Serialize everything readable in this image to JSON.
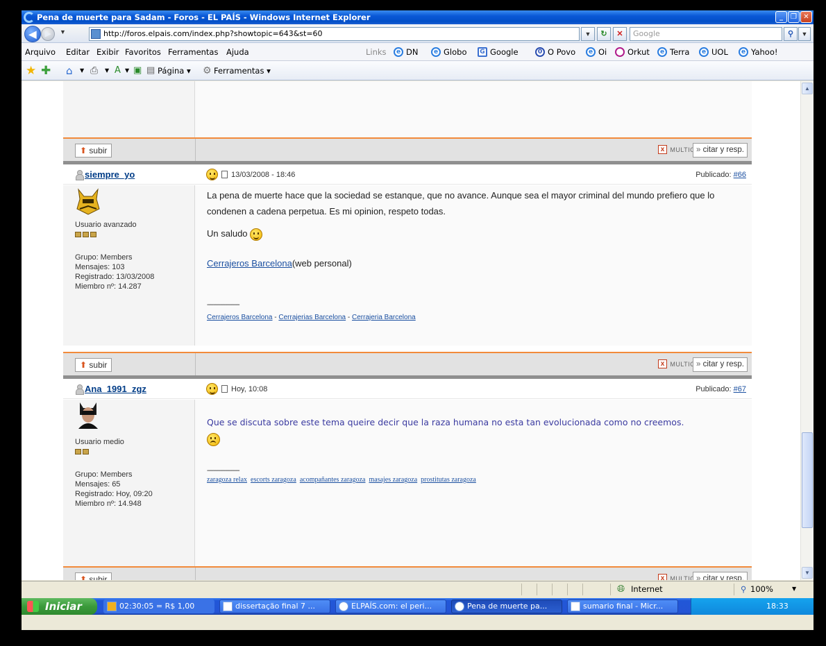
{
  "window": {
    "title": "Pena de muerte para Sadam - Foros - EL PAÍS - Windows Internet Explorer"
  },
  "address": {
    "url": "http://foros.elpais.com/index.php?showtopic=643&st=60",
    "search_placeholder": "Google"
  },
  "menu": [
    "Arquivo",
    "Editar",
    "Exibir",
    "Favoritos",
    "Ferramentas",
    "Ajuda"
  ],
  "links": {
    "label": "Links",
    "items": [
      "DN",
      "Globo",
      "Google",
      "O Povo",
      "Oi",
      "Orkut",
      "Terra",
      "UOL",
      "Yahoo!"
    ]
  },
  "command": {
    "pagina": "Página",
    "ferramentas": "Ferramentas"
  },
  "common": {
    "subir": "subir",
    "multicita": "MULTICITA",
    "citar": "citar y resp.",
    "publicado": "Publicado:"
  },
  "posts": [
    {
      "user": "siempre_yo",
      "date": "13/03/2008 - 18:46",
      "num": "#66",
      "role": "Usuario avanzado",
      "pips": 3,
      "grupo": "Grupo: Members",
      "mensajes": "Mensajes: 103",
      "registrado": "Registrado: 13/03/2008",
      "miembro": "Miembro nº: 14.287",
      "text1": "La pena de muerte hace que la sociedad se estanque, que no avance. Aunque sea el mayor criminal del mundo prefiero que lo",
      "text2": "condenen a cadena perpetua. Es mi opinion, respeto todas.",
      "saludo": "Un saludo",
      "link": "Cerrajeros Barcelona",
      "link_suffix": "(web personal)",
      "sigline": "--------------------",
      "sig": [
        "Cerrajeros Barcelona",
        "Cerrajerias Barcelona",
        "Cerrajeria Barcelona"
      ]
    },
    {
      "user": "Ana_1991_zgz",
      "date": "Hoy, 10:08",
      "num": "#67",
      "role": "Usuario medio",
      "pips": 2,
      "grupo": "Grupo: Members",
      "mensajes": "Mensajes: 65",
      "registrado": "Registrado: Hoy, 09:20",
      "miembro": "Miembro nº: 14.948",
      "text": "Que se discuta sobre este tema queire decir que la raza humana no esta tan evolucionada como no creemos.",
      "sigline": "--------------------",
      "sig": [
        "zaragoza relax",
        "escorts zaragoza",
        "acompañantes zaragoza",
        "masajes zaragoza",
        "prostitutas zaragoza"
      ]
    }
  ],
  "status": {
    "zone": "Internet",
    "zoom": "100%"
  },
  "taskbar": {
    "start": "Iniciar",
    "tasks": [
      "02:30:05 = R$ 1,00",
      "dissertação final 7 ...",
      "ELPAÍS.com: el peri...",
      "Pena de muerte pa...",
      "sumario final - Micr..."
    ],
    "clock": "18:33"
  }
}
